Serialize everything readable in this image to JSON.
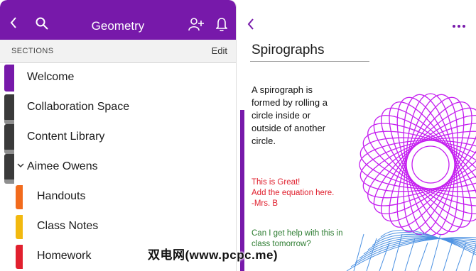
{
  "left": {
    "header": {
      "back_icon": "back-chevron",
      "search_icon": "search",
      "title": "Geometry",
      "add_user_icon": "add-person",
      "bell_icon": "bell"
    },
    "sections_label": "SECTIONS",
    "edit_label": "Edit",
    "sections": [
      {
        "label": "Welcome",
        "tab_color": "#7719aa"
      },
      {
        "label": "Collaboration Space",
        "tab_color": "#3a3a3a"
      },
      {
        "label": "Content Library",
        "tab_color": "#3a3a3a"
      },
      {
        "label": "Aimee Owens",
        "tab_color": "#3a3a3a",
        "expanded": true
      }
    ],
    "subsections": [
      {
        "label": "Handouts",
        "tab_color": "#f26b1d"
      },
      {
        "label": "Class Notes",
        "tab_color": "#f2b90f"
      },
      {
        "label": "Homework",
        "tab_color": "#e1202e"
      }
    ]
  },
  "right": {
    "back_icon": "back-chevron",
    "more_icon": "more-dots",
    "page_title": "Spirographs",
    "body": "A spirograph is formed by rolling a circle inside or outside of another circle.",
    "teacher_note": {
      "lines": [
        "This is Great!",
        "Add the equation here.",
        "-Mrs. B"
      ],
      "color": "#e0202e"
    },
    "student_note": {
      "lines": [
        "Can I get help with this in",
        "class tomorrow?"
      ],
      "color": "#2e7d32"
    }
  },
  "watermark": "双电网(www.pcpc.me)",
  "colors": {
    "accent": "#7719aa",
    "spiro": "#c51ff0",
    "mesh": "#4a90e2"
  }
}
